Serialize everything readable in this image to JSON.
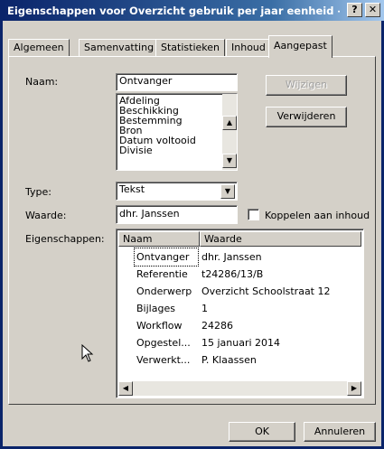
{
  "window": {
    "title": "Eigenschappen voor Overzicht gebruik per jaar eenheid - S...",
    "help_label": "?",
    "close_label": "✕"
  },
  "tabs": [
    "Algemeen",
    "Samenvatting",
    "Statistieken",
    "Inhoud",
    "Aangepast"
  ],
  "active_tab": "Aangepast",
  "form": {
    "naam_label": "Naam:",
    "naam_value": "Ontvanger",
    "naam_options": [
      "Afdeling",
      "Beschikking",
      "Bestemming",
      "Bron",
      "Datum voltooid",
      "Divisie"
    ],
    "wijzigen_label": "Wijzigen",
    "verwijderen_label": "Verwijderen",
    "type_label": "Type:",
    "type_value": "Tekst",
    "waarde_label": "Waarde:",
    "waarde_value": "dhr. Janssen",
    "koppelen_label": "Koppelen aan inhoud",
    "koppelen_checked": false,
    "eigenschappen_label": "Eigenschappen:"
  },
  "properties": {
    "columns": [
      "Naam",
      "Waarde"
    ],
    "rows": [
      {
        "name": "Ontvanger",
        "value": "dhr. Janssen",
        "selected": true
      },
      {
        "name": "Referentie",
        "value": "t24286/13/B"
      },
      {
        "name": "Onderwerp",
        "value": "Overzicht Schoolstraat 12"
      },
      {
        "name": "Bijlages",
        "value": "1"
      },
      {
        "name": "Workflow",
        "value": "24286"
      },
      {
        "name": "Opgestel...",
        "value": "15 januari 2014"
      },
      {
        "name": "Verwerkt...",
        "value": "P. Klaassen"
      }
    ]
  },
  "footer": {
    "ok_label": "OK",
    "cancel_label": "Annuleren"
  },
  "colors": {
    "titlebar_start": "#0a246a",
    "titlebar_end": "#a6caf0",
    "dialog_bg": "#d4d0c8",
    "desktop_bg": "#3aa6c4"
  }
}
